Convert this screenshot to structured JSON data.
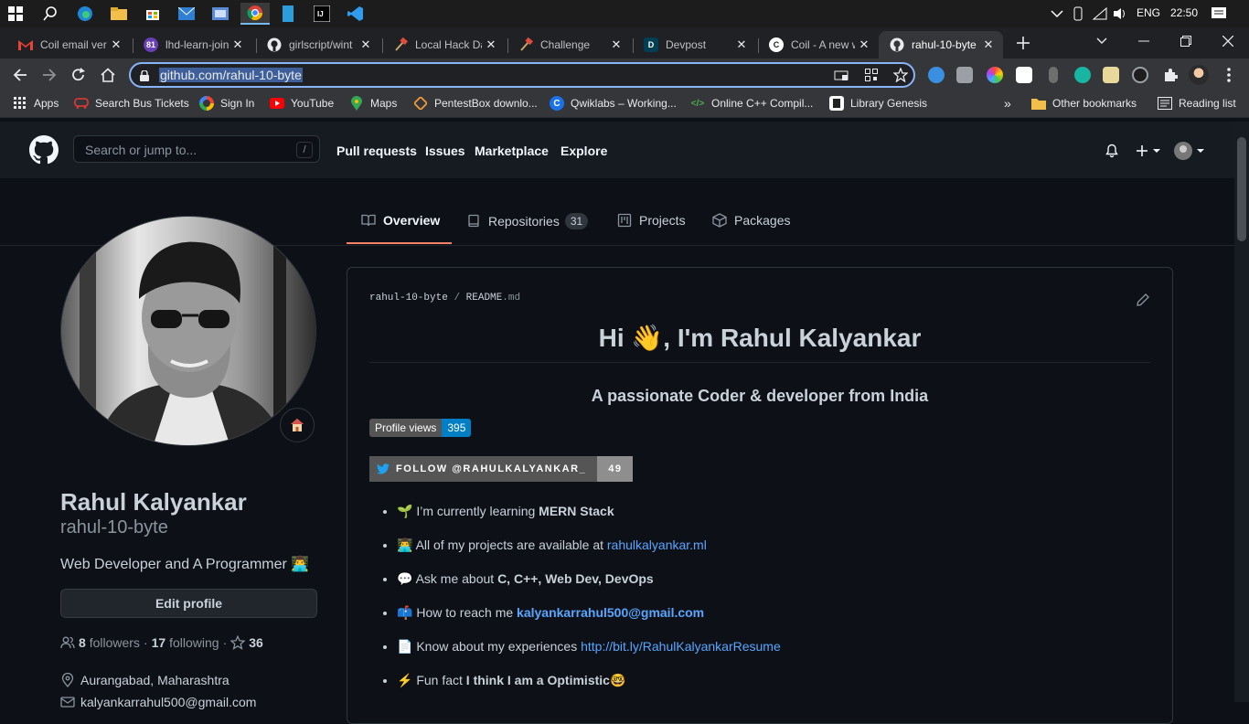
{
  "taskbar": {
    "language": "ENG",
    "time": "22:50"
  },
  "tabs": [
    {
      "title": "Coil email ver",
      "favicon": "gmail-icon"
    },
    {
      "title": "lhd-learn-join",
      "favicon": "badge-icon",
      "badge": "81"
    },
    {
      "title": "girlscript/wint",
      "favicon": "github-icon"
    },
    {
      "title": "Local Hack Da",
      "favicon": "hammer-icon"
    },
    {
      "title": "Challenge",
      "favicon": "hammer-icon"
    },
    {
      "title": "Devpost",
      "favicon": "devpost-icon"
    },
    {
      "title": "Coil - A new w",
      "favicon": "coil-icon"
    },
    {
      "title": "rahul-10-byte",
      "favicon": "github-icon",
      "active": true
    }
  ],
  "omnibox": {
    "url": "github.com/rahul-10-byte"
  },
  "bookmarks": {
    "items": [
      {
        "label": "Apps",
        "icon": "apps-grid-icon"
      },
      {
        "label": "Search Bus Tickets",
        "icon": "bus-icon"
      },
      {
        "label": "Sign In",
        "icon": "google-icon"
      },
      {
        "label": "YouTube",
        "icon": "youtube-icon"
      },
      {
        "label": "Maps",
        "icon": "maps-pin-icon"
      },
      {
        "label": "PentestBox downlo...",
        "icon": "pentestbox-icon"
      },
      {
        "label": "Qwiklabs – Working...",
        "icon": "qwiklabs-icon"
      },
      {
        "label": "Online C++ Compil...",
        "icon": "code-icon"
      },
      {
        "label": "Library Genesis",
        "icon": "libgen-icon"
      }
    ],
    "overflow": "»",
    "other": "Other bookmarks",
    "reading_list": "Reading list"
  },
  "github": {
    "search_placeholder": "Search or jump to...",
    "search_key": "/",
    "nav": [
      "Pull requests",
      "Issues",
      "Marketplace",
      "Explore"
    ]
  },
  "profile_tabs": [
    {
      "label": "Overview",
      "icon": "book-icon",
      "active": true
    },
    {
      "label": "Repositories",
      "icon": "repo-icon",
      "count": "31"
    },
    {
      "label": "Projects",
      "icon": "project-icon"
    },
    {
      "label": "Packages",
      "icon": "package-icon"
    }
  ],
  "profile": {
    "full_name": "Rahul Kalyankar",
    "username": "rahul-10-byte",
    "bio": "Web Developer and A Programmer 👨‍💻",
    "edit_label": "Edit profile",
    "followers_count": "8",
    "followers_label": "followers",
    "following_count": "17",
    "following_label": "following",
    "stars": "36",
    "location": "Aurangabad, Maharashtra",
    "email": "kalyankarrahul500@gmail.com"
  },
  "readme": {
    "path_user": "rahul-10-byte",
    "path_sep": "/",
    "path_file": "README",
    "path_ext": ".md",
    "heading": "Hi 👋, I'm Rahul Kalyankar",
    "subheading": "A passionate Coder & developer from India",
    "views_label": "Profile views",
    "views_count": "395",
    "twitter_label": "FOLLOW @RAHULKALYANKAR_",
    "twitter_count": "49",
    "items": [
      {
        "emoji": "🌱",
        "pre": "I’m currently learning ",
        "bold": "MERN Stack"
      },
      {
        "emoji": "👨‍💻",
        "pre": "All of my projects are available at ",
        "link": "rahulkalyankar.ml"
      },
      {
        "emoji": "💬",
        "pre": "Ask me about ",
        "bold": "C, C++, Web Dev, DevOps"
      },
      {
        "emoji": "📫",
        "pre": "How to reach me ",
        "link": "kalyankarrahul500@gmail.com"
      },
      {
        "emoji": "📄",
        "pre": "Know about my experiences ",
        "link": "http://bit.ly/RahulKalyankarResume"
      },
      {
        "emoji": "⚡",
        "pre": "Fun fact ",
        "bold": "I think I am a Optimistic",
        "post": "🤓"
      }
    ]
  }
}
